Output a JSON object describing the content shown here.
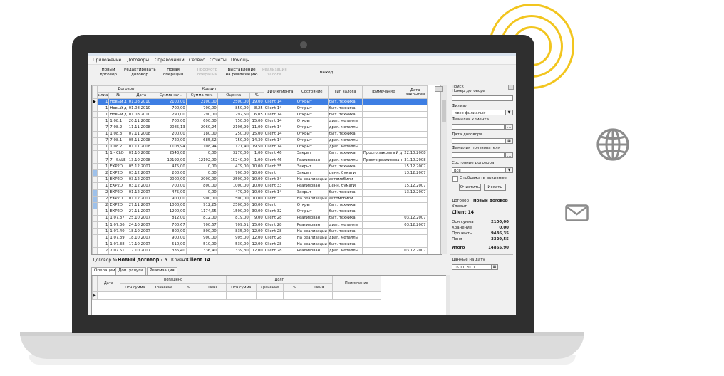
{
  "menu": [
    "Приложение",
    "Договоры",
    "Справочники",
    "Сервис",
    "Отчеты",
    "Помощь"
  ],
  "toolbar": {
    "new_contract": "Новый\nдоговор",
    "edit_contract": "Редактировать\nдоговор",
    "new_operation": "Новая\nоперация",
    "view_operation": "Просмотр\nоперации",
    "put_on_sale": "Выставление\nна реализацию",
    "realize_pledge": "Реализация\nзалога",
    "exit": "Выход"
  },
  "grid": {
    "group_contract": "Договор",
    "group_credit": "Кредит",
    "headers": [
      "илиа",
      "№",
      "Дата",
      "Сумма нач.",
      "Сумма тек.",
      "Оценка",
      "%",
      "ФИО клиента",
      "Состояние",
      "Тип залога",
      "Примечание",
      "Дата закрытия"
    ],
    "rows": [
      [
        "1",
        "Новый д",
        "01.08.2010",
        "2100,00",
        "2100,00",
        "2500,00",
        "19,00",
        "Client 14",
        "Открыт",
        "быт. техника",
        "",
        ""
      ],
      [
        "1",
        "Новый д",
        "01.08.2010",
        "700,00",
        "700,00",
        "850,00",
        "8,25",
        "Client 14",
        "Открыт",
        "быт. техника",
        "",
        ""
      ],
      [
        "1",
        "Новый д",
        "01.08.2010",
        "290,00",
        "290,00",
        "292,50",
        "6,05",
        "Client 14",
        "Открыт",
        "быт. техника",
        "",
        ""
      ],
      [
        "1",
        "1.08.1",
        "20.11.2008",
        "700,00",
        "690,00",
        "750,00",
        "15,00",
        "Client 14",
        "Открыт",
        "драг. металлы",
        "",
        ""
      ],
      [
        "7",
        "7.08.2",
        "11.11.2008",
        "2085,13",
        "2060,24",
        "2106,99",
        "11,00",
        "Client 14",
        "Открыт",
        "драг. металлы",
        "",
        ""
      ],
      [
        "1",
        "1.08.3",
        "07.11.2008",
        "200,00",
        "180,00",
        "250,00",
        "15,00",
        "Client 14",
        "Открыт",
        "быт. техника",
        "",
        ""
      ],
      [
        "7",
        "7.08.1",
        "05.11.2008",
        "720,00",
        "685,52",
        "750,00",
        "14,30",
        "Client 14",
        "Открыт",
        "драг. металлы",
        "",
        ""
      ],
      [
        "1",
        "1.08.2",
        "01.11.2008",
        "1108,94",
        "1108,94",
        "1121,40",
        "19,50",
        "Client 14",
        "Открыт",
        "драг. металлы",
        "",
        ""
      ],
      [
        "1",
        "1 - CLO",
        "01.10.2008",
        "2543,08",
        "0,00",
        "3270,00",
        "1,00",
        "Client 46",
        "Закрыт",
        "быт. техника",
        "Просто закрытый д",
        "22.10.2008"
      ],
      [
        "7",
        "7 - SALE",
        "13.10.2008",
        "12192,00",
        "12192,00",
        "15240,00",
        "1,00",
        "Client 46",
        "Реализован",
        "драг. металлы",
        "Просто реализован",
        "31.10.2008"
      ],
      [
        "1",
        "EXP2D",
        "05.12.2007",
        "475,00",
        "0,00",
        "479,00",
        "10,00",
        "Client 35",
        "Закрыт",
        "быт. техника",
        "",
        "15.12.2007"
      ],
      [
        "2",
        "EXP2D",
        "03.12.2007",
        "200,00",
        "0,00",
        "700,00",
        "10,00",
        "Client",
        "Закрыт",
        "ценн. бумаги",
        "",
        "13.12.2007"
      ],
      [
        "1",
        "EXP2D",
        "03.12.2007",
        "2000,00",
        "2000,00",
        "2500,00",
        "10,00",
        "Client 34",
        "На реализации",
        "автомобили",
        "",
        ""
      ],
      [
        "1",
        "EXP2D",
        "03.12.2007",
        "700,00",
        "800,00",
        "1000,00",
        "10,00",
        "Client 33",
        "Реализован",
        "ценн. бумаги",
        "",
        "15.12.2007"
      ],
      [
        "2",
        "EXP2D",
        "01.12.2007",
        "475,00",
        "0,00",
        "479,00",
        "10,00",
        "Client 14",
        "Закрыт",
        "быт. техника",
        "",
        "13.12.2007"
      ],
      [
        "2",
        "EXP2D",
        "01.12.2007",
        "900,00",
        "900,00",
        "1500,00",
        "10,00",
        "Client",
        "На реализации",
        "автомобили",
        "",
        ""
      ],
      [
        "2",
        "EXP2D",
        "27.11.2007",
        "1000,00",
        "912,25",
        "2500,00",
        "10,00",
        "Client",
        "Открыт",
        "быт. техника",
        "",
        ""
      ],
      [
        "1",
        "EXP2D",
        "27.11.2007",
        "1200,00",
        "1174,65",
        "1500,00",
        "30,00",
        "Client 32",
        "Открыт",
        "быт. техника",
        "",
        ""
      ],
      [
        "1",
        "1.07.37",
        "25.10.2007",
        "812,00",
        "812,00",
        "819,00",
        "9,00",
        "Client 28",
        "Реализован",
        "быт. техника",
        "",
        "03.12.2007"
      ],
      [
        "1",
        "1.07.36",
        "24.10.2007",
        "700,67",
        "700,67",
        "709,51",
        "15,00",
        "Client 28",
        "Реализован",
        "драг. металлы",
        "",
        "03.12.2007"
      ],
      [
        "1",
        "1.07.40",
        "18.10.2007",
        "800,00",
        "800,00",
        "835,00",
        "12,00",
        "Client 28",
        "На реализации",
        "быт. техника",
        "",
        ""
      ],
      [
        "1",
        "1.07.39",
        "18.10.2007",
        "900,00",
        "900,00",
        "905,00",
        "12,00",
        "Client 28",
        "На реализации",
        "драг. металлы",
        "",
        ""
      ],
      [
        "1",
        "1.07.38",
        "17.10.2007",
        "510,00",
        "510,00",
        "530,00",
        "12,00",
        "Client 28",
        "На реализации",
        "быт. техника",
        "",
        ""
      ],
      [
        "7",
        "7.07.51",
        "17.10.2007",
        "336,40",
        "336,40",
        "339,30",
        "12,00",
        "Client 28",
        "Реализован",
        "драг. металлы",
        "",
        "03.12.2007"
      ]
    ]
  },
  "detail": {
    "contract_label": "Договор №",
    "contract_value": "Новый договор - 5",
    "client_label": "Клиент",
    "client_value": "Client 14",
    "tabs": [
      "Операции",
      "Доп. услуги",
      "Реализация"
    ],
    "sub_headers_top": [
      "Дата",
      "Погашено",
      "Долг",
      "Примечание"
    ],
    "sub_headers": [
      "Осн.сумма",
      "Хранение",
      "%",
      "Пеня",
      "Осн.сумма",
      "Хранение",
      "%",
      "Пеня"
    ]
  },
  "filter": {
    "search_label": "Поиск",
    "contract_no_label": "Номер договора",
    "branch_label": "Филиал",
    "branch_value": "<все филиалы>",
    "client_name_label": "Фамилия клиента",
    "contract_date_label": "Дата договора",
    "contract_date_value": " . . ",
    "user_name_label": "Фамилия пользователя",
    "state_label": "Состояние договора",
    "state_value": "Все",
    "show_archived_label": "Отображать архивные",
    "clear_label": "Очистить",
    "search_button": "Искать",
    "browse_symbol": "..."
  },
  "summary": {
    "contract_label": "Договор",
    "contract_value": "Новый договор",
    "client_label": "Клиент",
    "client_value": "Client 14",
    "rows": [
      {
        "label": "Осн сумма",
        "value": "2100,00"
      },
      {
        "label": "Хранение",
        "value": "0,00"
      },
      {
        "label": "Проценты",
        "value": "9436,35"
      },
      {
        "label": "Пеня",
        "value": "3329,55"
      }
    ],
    "total_label": "Итого",
    "total_value": "14865,90",
    "date_label": "Данные на дату",
    "date_value": "16.11.2011"
  },
  "colors": {
    "accent_ring": "#f2c51e",
    "selected_row": "#3d7ee3",
    "bezel": "#2f2f2f",
    "side_icons": "#8c8c8c"
  },
  "icons": [
    "globe-icon",
    "mail-icon",
    "dropdown-arrow-icon",
    "calendar-icon"
  ]
}
